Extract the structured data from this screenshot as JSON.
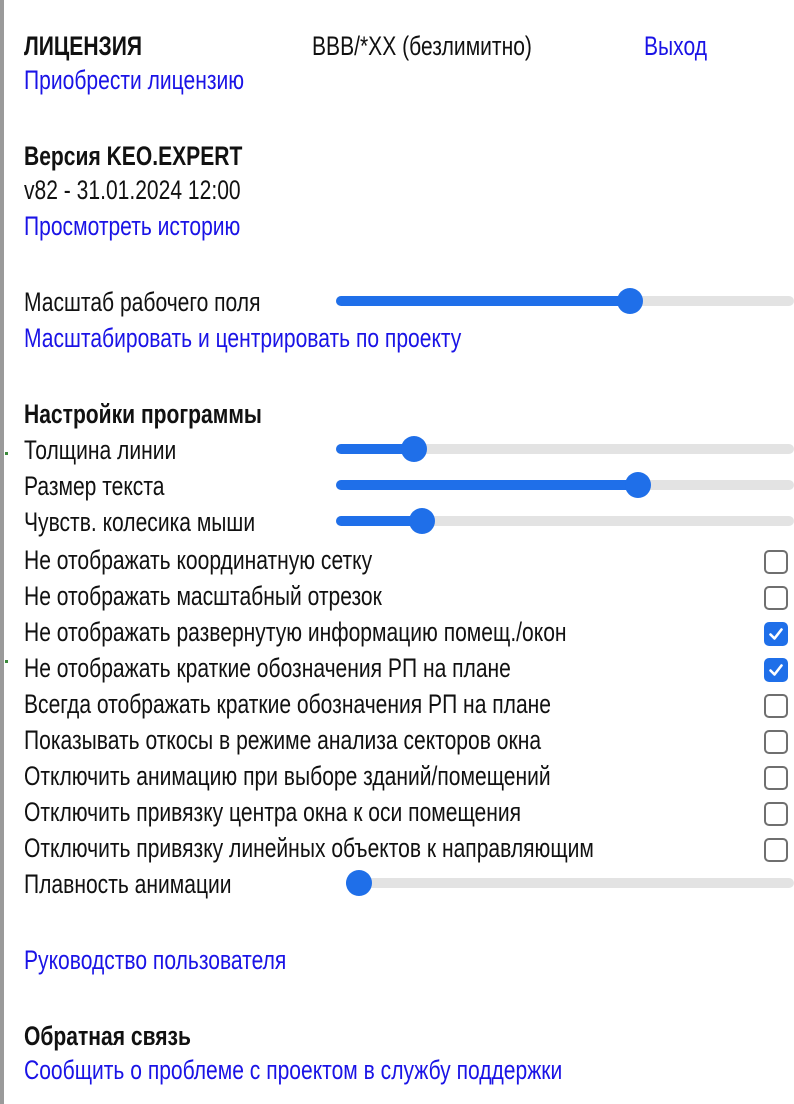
{
  "license": {
    "heading": "ЛИЦЕНЗИЯ",
    "value": "BBB/*XX (безлимитно)",
    "logout": "Выход",
    "buy": "Приобрести лицензию"
  },
  "version": {
    "heading": "Версия KEO.EXPERT",
    "value": "v82 - 31.01.2024 12:00",
    "history": "Просмотреть историю"
  },
  "workspace": {
    "scale_label": "Масштаб рабочего поля",
    "scale_value": 0.65,
    "fit_link": "Масштабировать и центрировать по проекту"
  },
  "settings": {
    "heading": "Настройки программы",
    "sliders": [
      {
        "label": "Толщина линии",
        "value": 0.15
      },
      {
        "label": "Размер текста",
        "value": 0.67
      },
      {
        "label": "Чувств. колесика мыши",
        "value": 0.17
      }
    ],
    "checkboxes": [
      {
        "label": "Не отображать координатную сетку",
        "checked": false
      },
      {
        "label": "Не отображать масштабный отрезок",
        "checked": false
      },
      {
        "label": "Не отображать развернутую информацию помещ./окон",
        "checked": true
      },
      {
        "label": "Не отображать краткие обозначения РП на плане",
        "checked": true
      },
      {
        "label": "Всегда отображать краткие обозначения РП на плане",
        "checked": false
      },
      {
        "label": "Показывать откосы в режиме анализа секторов окна",
        "checked": false
      },
      {
        "label": "Отключить анимацию при выборе зданий/помещений",
        "checked": false
      },
      {
        "label": "Отключить привязку центра окна к оси помещения",
        "checked": false
      },
      {
        "label": "Отключить привязку линейных объектов к направляющим",
        "checked": false
      }
    ],
    "animation": {
      "label": "Плавность анимации",
      "value": 0.0
    }
  },
  "manual_link": "Руководство пользователя",
  "feedback": {
    "heading": "Обратная связь",
    "report_link": "Сообщить о проблеме с проектом в службу поддержки"
  },
  "colors": {
    "link": "#1a13e6",
    "accent": "#1f6fe9",
    "track": "#e3e3e3"
  }
}
